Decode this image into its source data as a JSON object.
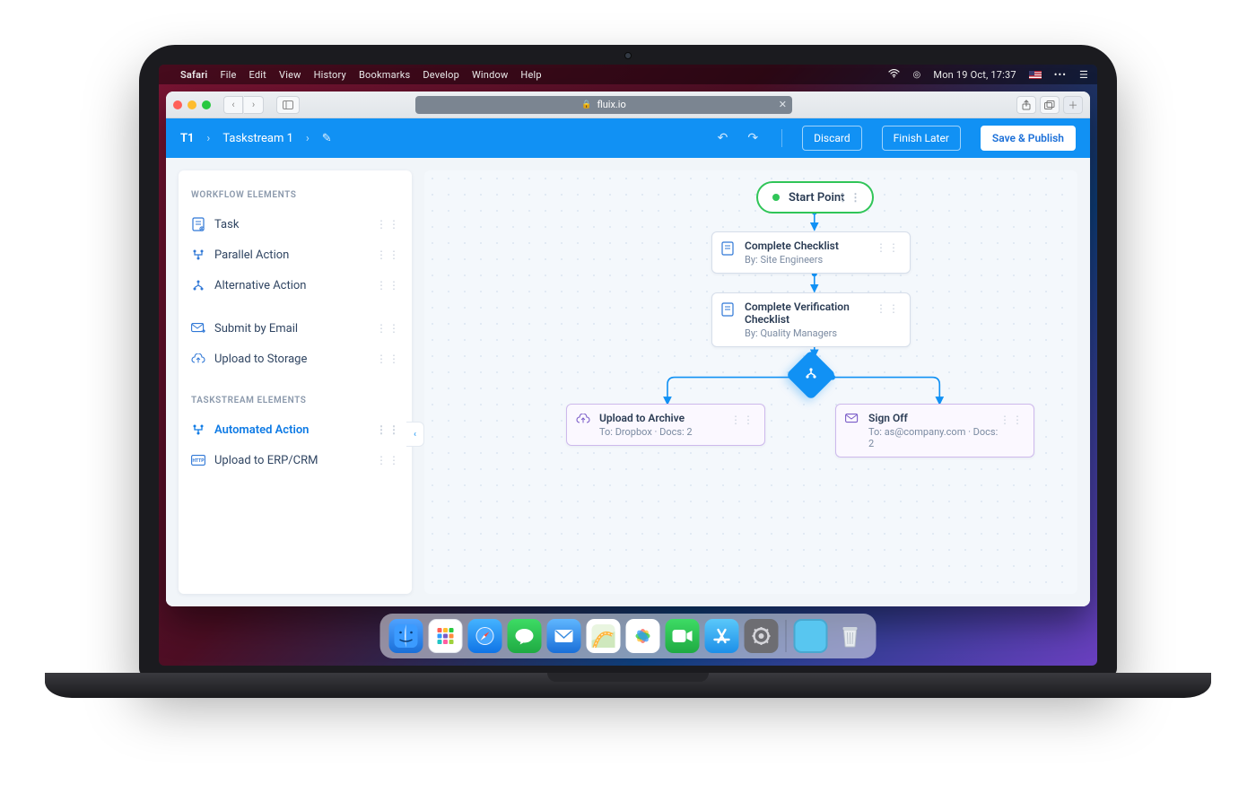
{
  "mac": {
    "app": "Safari",
    "menus": [
      "File",
      "Edit",
      "View",
      "History",
      "Bookmarks",
      "Develop",
      "Window",
      "Help"
    ],
    "clock": "Mon 19 Oct, 17:37",
    "url": "fluix.io"
  },
  "header": {
    "crumb_tag": "T1",
    "crumb_title": "Taskstream 1",
    "discard": "Discard",
    "later": "Finish Later",
    "publish": "Save & Publish"
  },
  "sidebar": {
    "section1_title": "WORKFLOW ELEMENTS",
    "section2_title": "TASKSTREAM ELEMENTS",
    "items1": [
      {
        "label": "Task"
      },
      {
        "label": "Parallel Action"
      },
      {
        "label": "Alternative Action"
      },
      {
        "label": "Submit by Email"
      },
      {
        "label": "Upload to Storage"
      }
    ],
    "items2": [
      {
        "label": "Automated Action"
      },
      {
        "label": "Upload to ERP/CRM"
      }
    ]
  },
  "canvas": {
    "start_label": "Start Point",
    "node1": {
      "title": "Complete Checklist",
      "sub": "By: Site Engineers"
    },
    "node2": {
      "title": "Complete Verification Checklist",
      "sub": "By: Quality Managers"
    },
    "node3": {
      "title": "Upload to Archive",
      "sub": "To: Dropbox  ·  Docs: 2"
    },
    "node4": {
      "title": "Sign Off",
      "sub": "To: as@company.com  ·  Docs: 2"
    }
  }
}
